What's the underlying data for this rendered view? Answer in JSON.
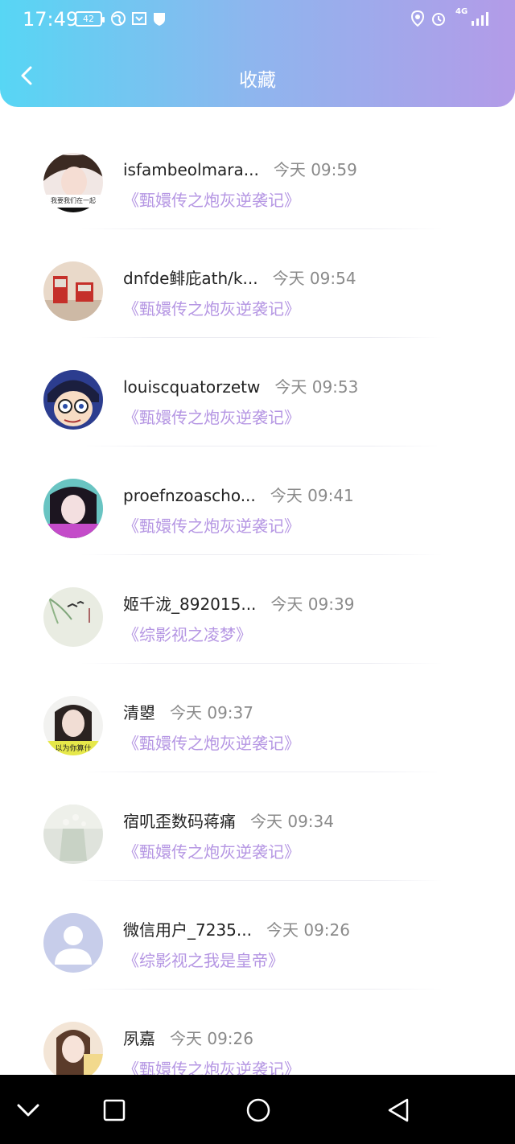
{
  "status_bar": {
    "time": "17:49",
    "battery": "42",
    "network": "4G"
  },
  "header": {
    "title": "收藏",
    "back_icon": "chevron-left-icon"
  },
  "colors": {
    "header_gradient_start": "#57d6f4",
    "header_gradient_end": "#b39be8",
    "book_title": "#b596e3",
    "time_text": "#8a8a8a"
  },
  "items": [
    {
      "username": "isfambeolmara...",
      "time": "今天 09:59",
      "book": "《甄嬛传之炮灰逆袭记》",
      "avatar_text": "我要我们在一起"
    },
    {
      "username": "dnfde鲱庇ath/k...",
      "time": "今天 09:54",
      "book": "《甄嬛传之炮灰逆袭记》",
      "avatar_text": ""
    },
    {
      "username": "louiscquatorzetw",
      "time": "今天 09:53",
      "book": "《甄嬛传之炮灰逆袭记》",
      "avatar_text": ""
    },
    {
      "username": "proefnzoascho...",
      "time": "今天 09:41",
      "book": "《甄嬛传之炮灰逆袭记》",
      "avatar_text": ""
    },
    {
      "username": "姬千泷_892015...",
      "time": "今天 09:39",
      "book": "《综影视之凌梦》",
      "avatar_text": ""
    },
    {
      "username": "清曌",
      "time": "今天 09:37",
      "book": "《甄嬛传之炮灰逆袭记》",
      "avatar_text": "以为你算什"
    },
    {
      "username": "宿叽歪数码蒋痛",
      "time": "今天 09:34",
      "book": "《甄嬛传之炮灰逆袭记》",
      "avatar_text": ""
    },
    {
      "username": "微信用户_7235...",
      "time": "今天 09:26",
      "book": "《综影视之我是皇帝》",
      "avatar_text": ""
    },
    {
      "username": "夙嘉",
      "time": "今天 09:26",
      "book": "《甄嬛传之炮灰逆袭记》",
      "avatar_text": ""
    }
  ],
  "system_nav": {
    "buttons": [
      "chevron-down-icon",
      "square-recents-icon",
      "circle-home-icon",
      "triangle-back-icon"
    ]
  }
}
